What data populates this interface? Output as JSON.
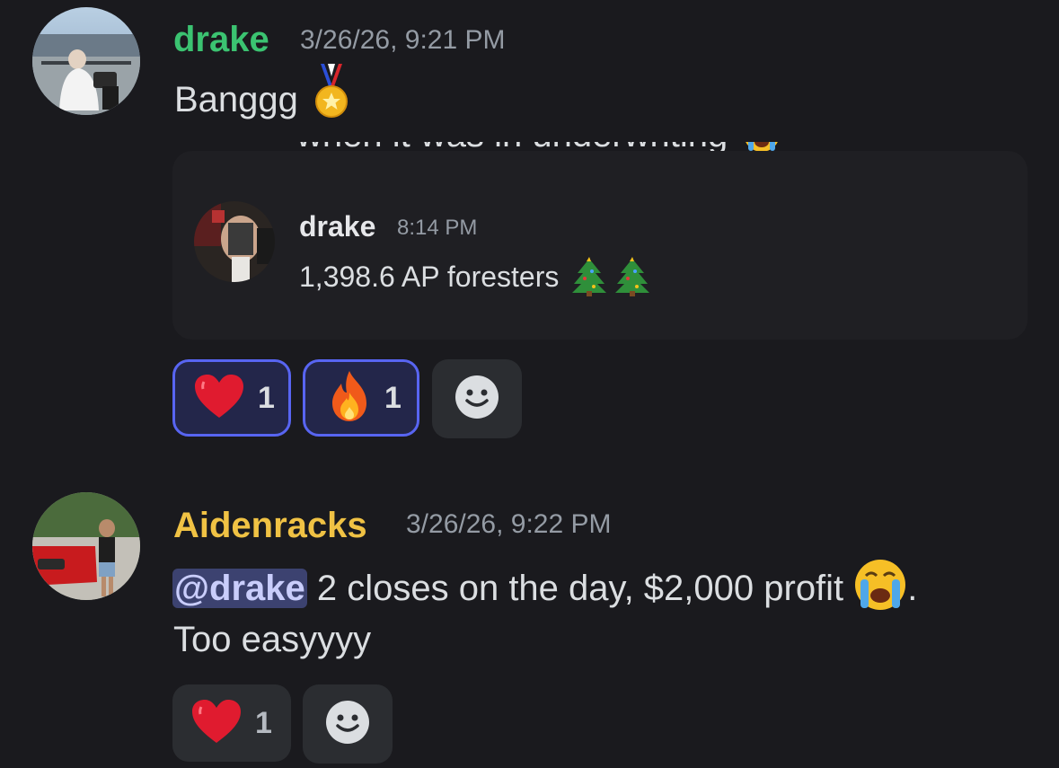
{
  "colors": {
    "background": "#1a1a1e",
    "drake_username": "#3bc371",
    "aidenracks_username": "#f0c244",
    "reaction_active_border": "#5865f2",
    "mention_bg": "#3c4270"
  },
  "messages": [
    {
      "username": "drake",
      "timestamp": "3/26/26, 9:21 PM",
      "text": "Banggg",
      "emoji": "medal-icon",
      "embed": {
        "cut_text": "when it was in underwriting",
        "username": "drake",
        "timestamp": "8:14 PM",
        "text": "1,398.6 AP  foresters",
        "emojis": [
          "christmas-tree-icon",
          "christmas-tree-icon"
        ]
      },
      "reactions": [
        {
          "emoji": "heart-icon",
          "count": "1",
          "active": true
        },
        {
          "emoji": "fire-icon",
          "count": "1",
          "active": true
        }
      ]
    },
    {
      "username": "Aidenracks",
      "timestamp": "3/26/26, 9:22 PM",
      "mention": "@drake",
      "text_line1": " 2 closes on the day, $2,000 profit ",
      "text_line1_end": ".",
      "text_line2": "Too easyyyy",
      "emoji": "crying-face-icon",
      "reactions": [
        {
          "emoji": "heart-icon",
          "count": "1",
          "active": false
        }
      ]
    }
  ]
}
